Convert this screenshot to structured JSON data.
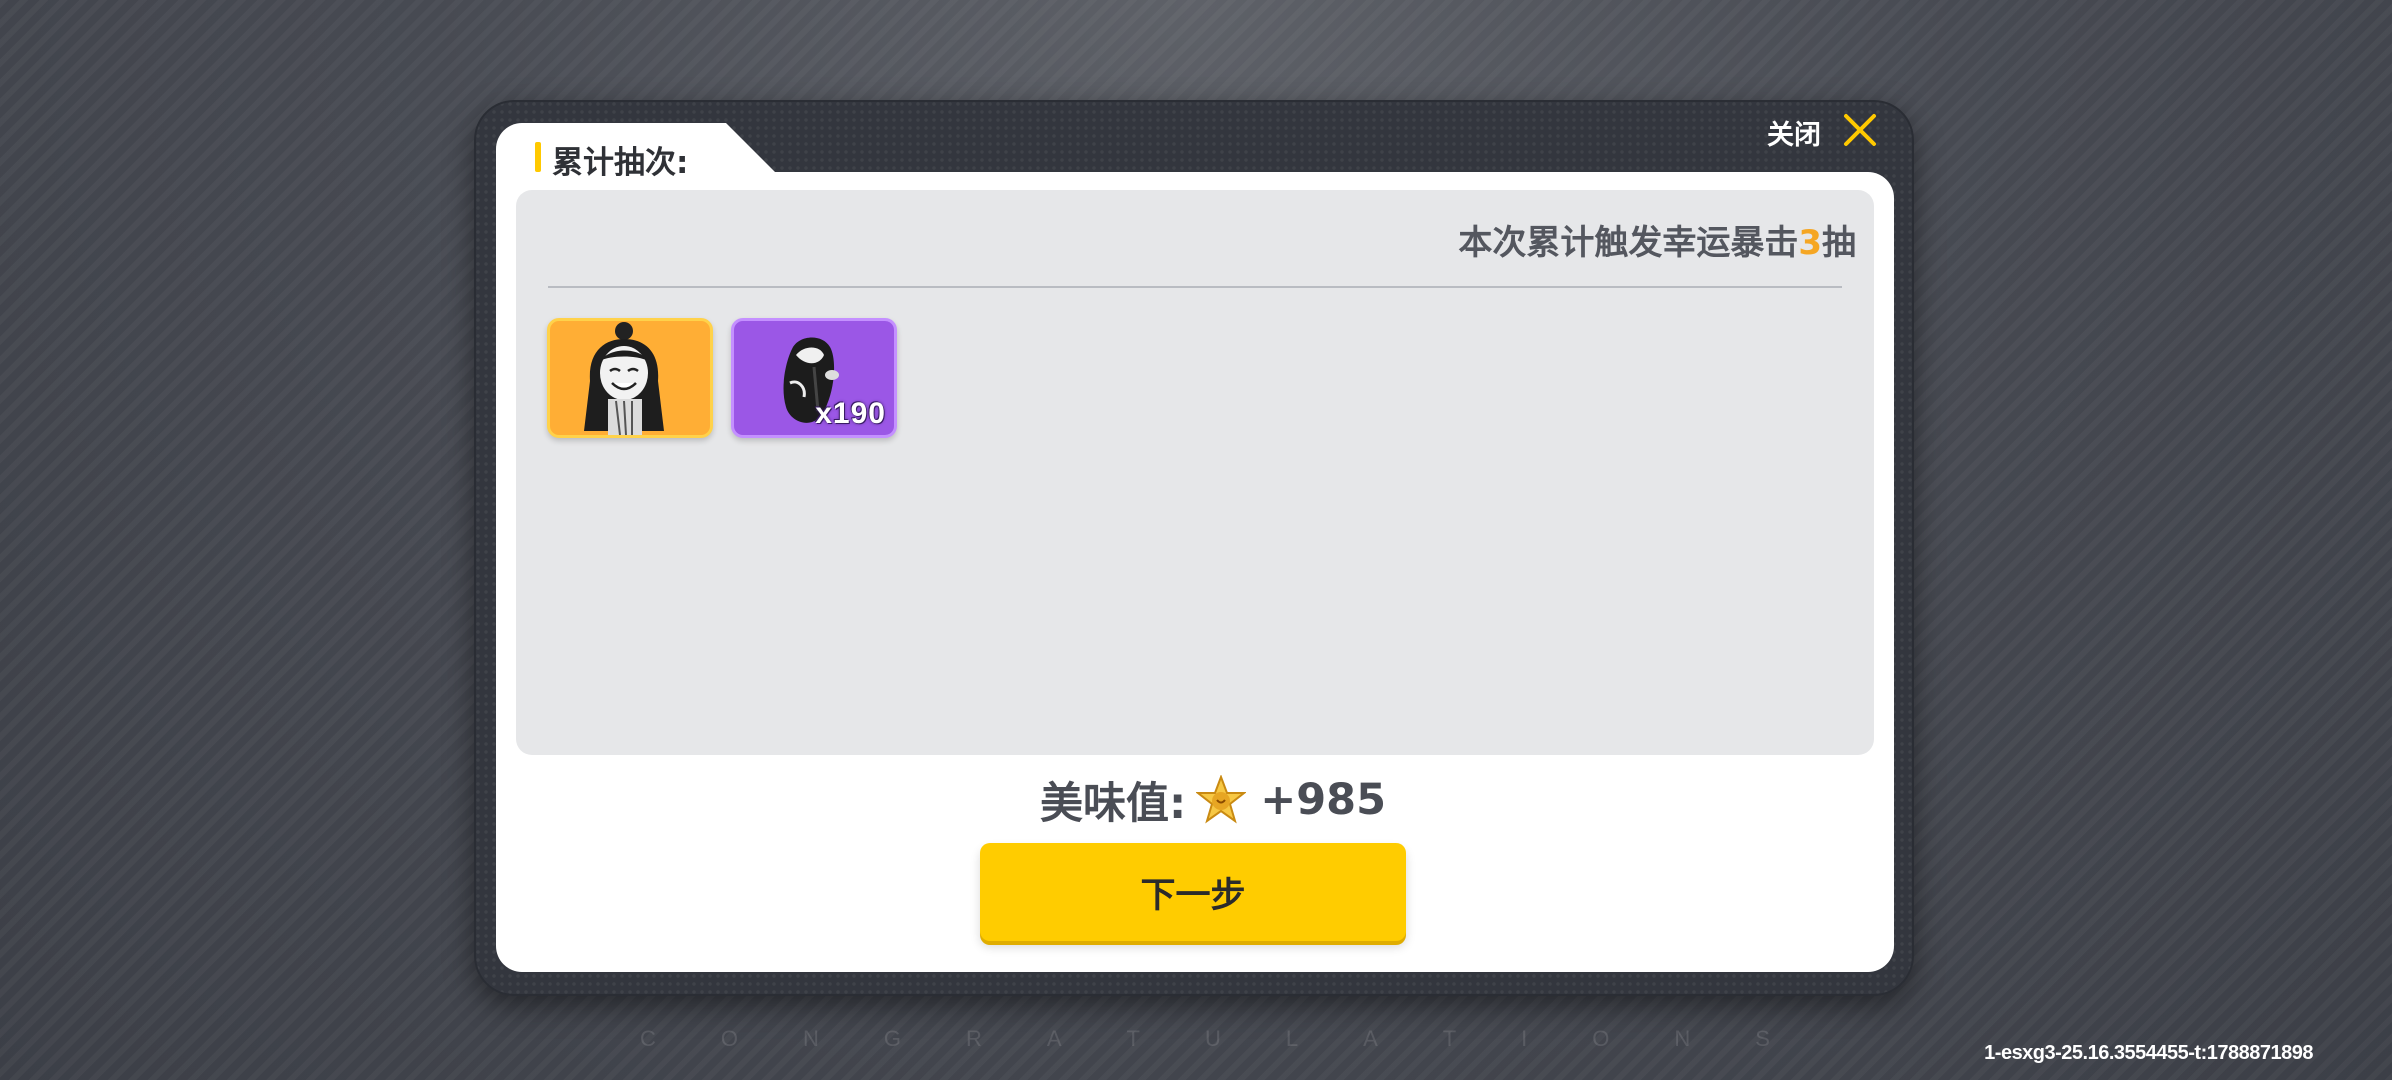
{
  "background": {
    "congrats_letters": [
      "C",
      "O",
      "N",
      "G",
      "R",
      "A",
      "T",
      "U",
      "L",
      "A",
      "T",
      "I",
      "O",
      "N",
      "S"
    ],
    "build_id": "1-esxg3-25.16.3554455-t:1788871898"
  },
  "dialog": {
    "title": "累计抽次:",
    "close_label": "关闭",
    "crit_prefix": "本次累计触发幸运暴击",
    "crit_count": "3",
    "crit_suffix": "抽",
    "items": [
      {
        "rarity_color": "#ffae35",
        "icon": "character-portrait-icon",
        "quantity": ""
      },
      {
        "rarity_color": "#9b57e6",
        "icon": "hair-fragment-icon",
        "quantity": "x190"
      }
    ],
    "score_label": "美味值:",
    "score_icon": "star-coin-icon",
    "score_value": "+985",
    "next_label": "下一步"
  },
  "colors": {
    "accent": "#ffcc00",
    "crit_number": "#f5a623"
  }
}
